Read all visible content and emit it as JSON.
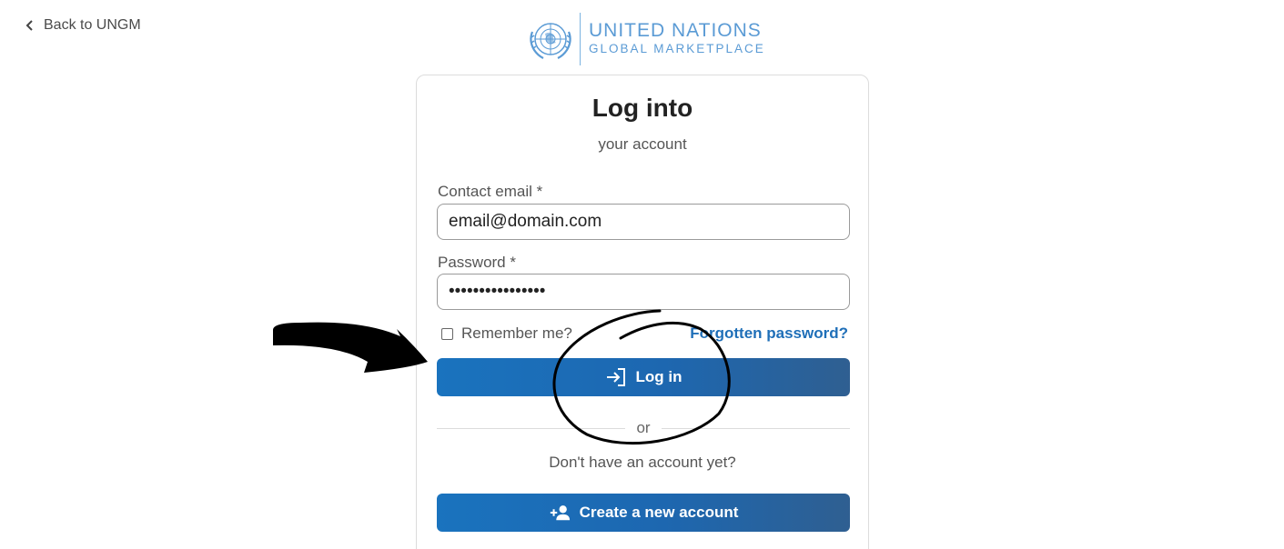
{
  "back_link": {
    "label": "Back to UNGM"
  },
  "logo": {
    "line1": "UNITED NATIONS",
    "line2": "GLOBAL MARKETPLACE"
  },
  "form": {
    "title": "Log into",
    "subtitle": "your account",
    "email_label": "Contact email *",
    "email_value": "email@domain.com",
    "password_label": "Password *",
    "password_value": "••••••••••••••••",
    "remember_label": "Remember me?",
    "remember_checked": false,
    "forgot_label": "Forgotten password?",
    "login_label": "Log in",
    "or_label": "or",
    "no_account_text": "Don't have an account yet?",
    "create_label": "Create a new account"
  },
  "colors": {
    "brand_blue": "#1a73be",
    "link_blue": "#1f6fb8",
    "logo_blue": "#5b9bd5"
  },
  "icons": [
    "chevron-left-icon",
    "un-emblem-icon",
    "login-arrow-icon",
    "add-user-icon"
  ]
}
